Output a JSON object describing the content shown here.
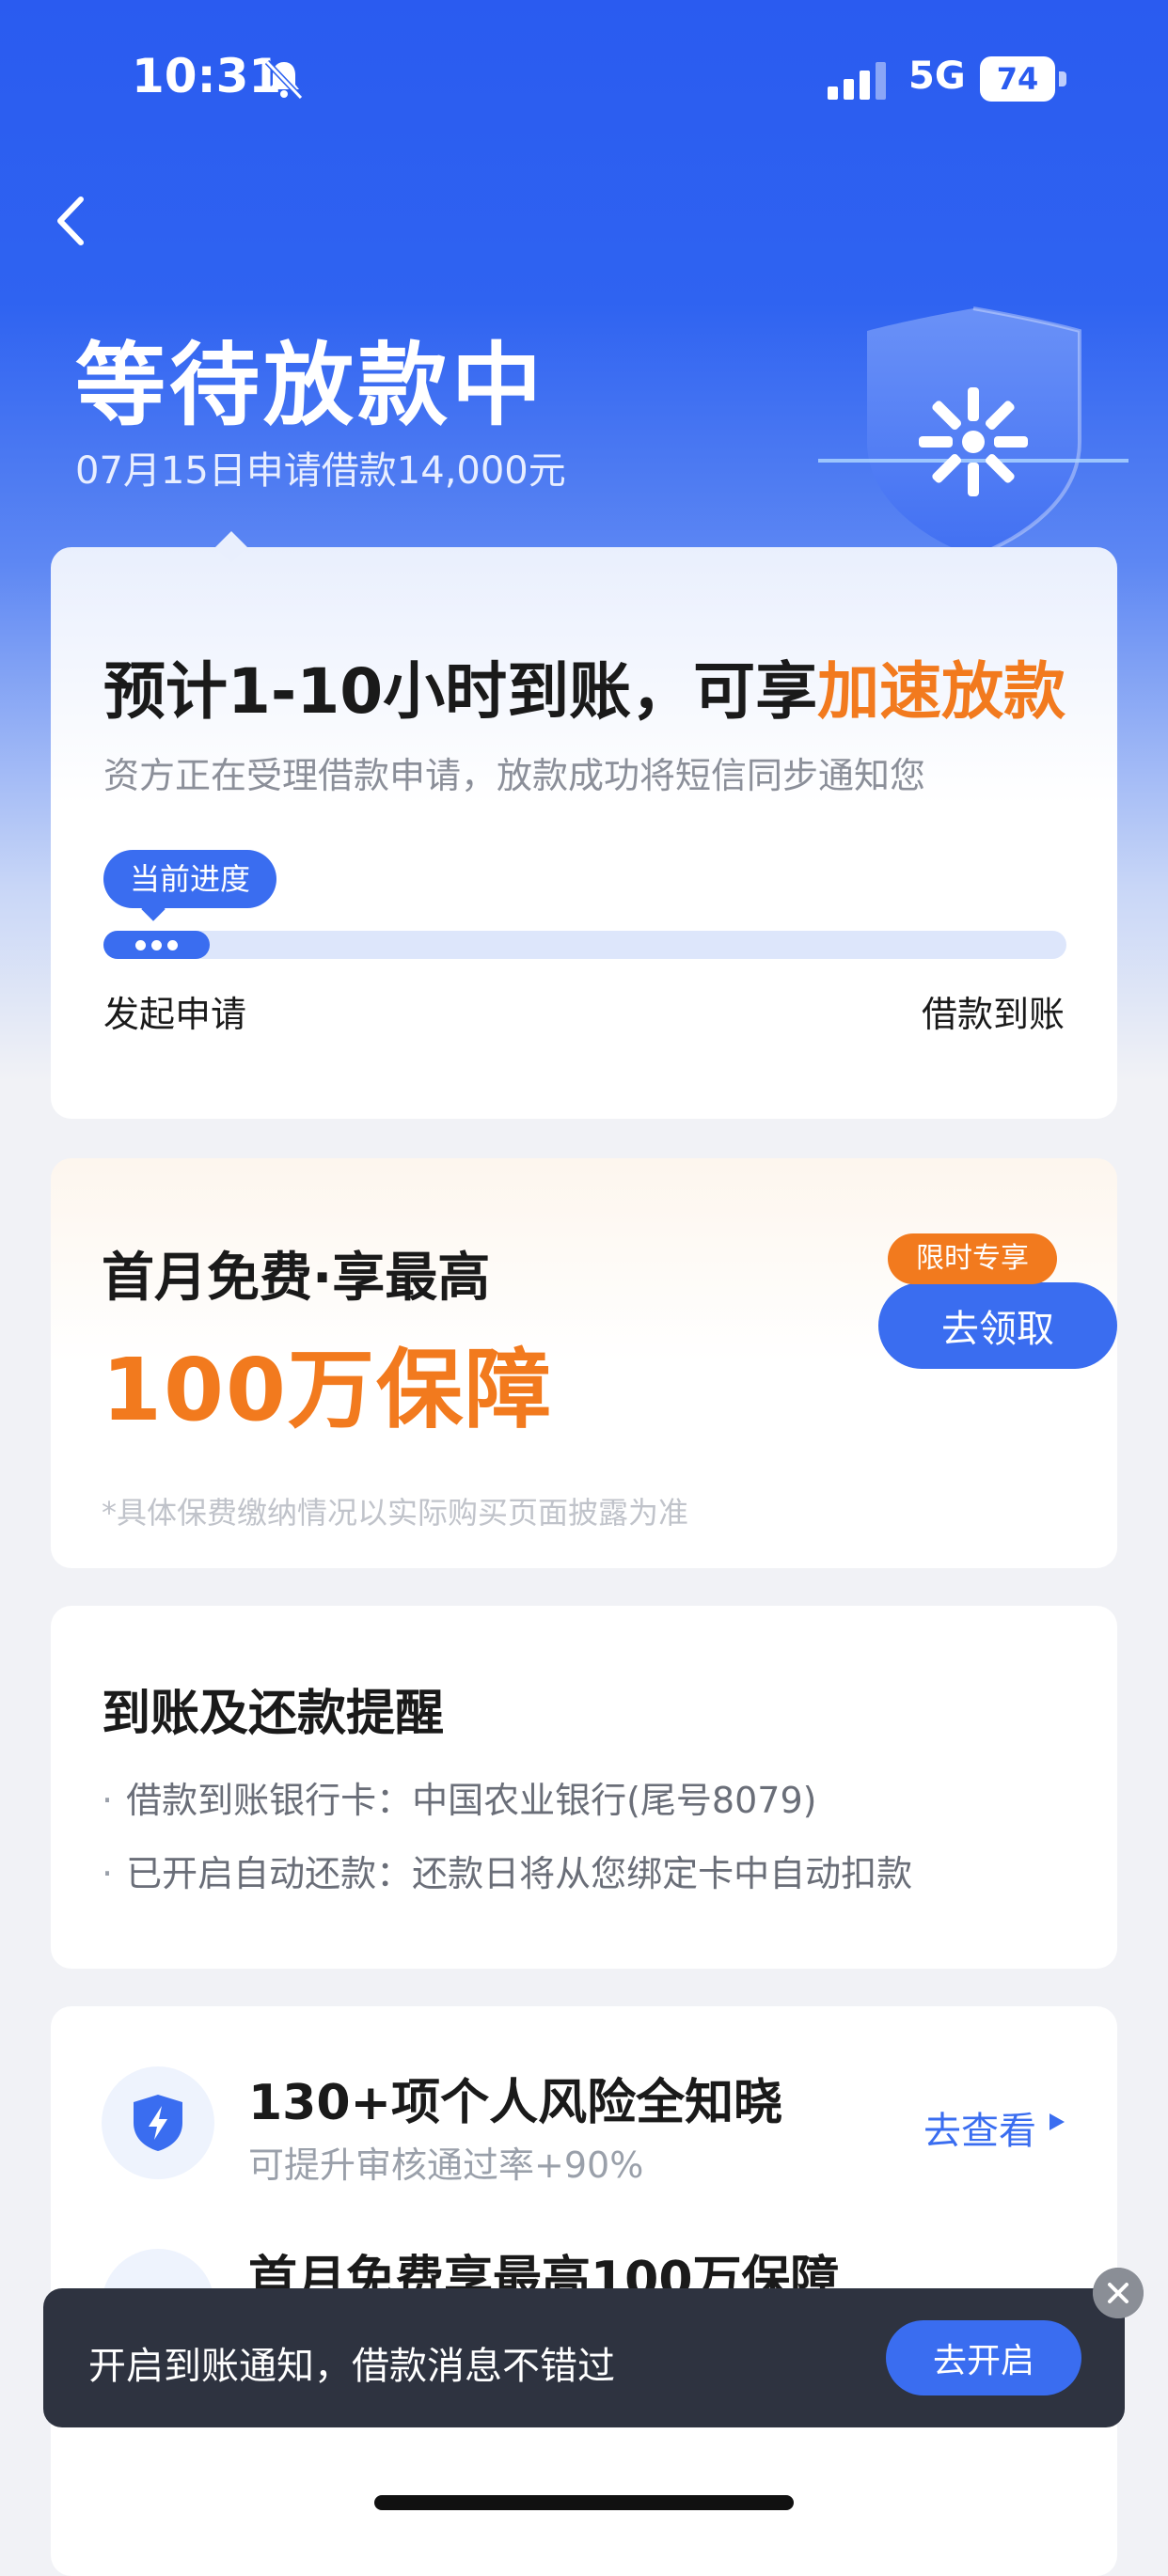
{
  "status_bar": {
    "time": "10:31",
    "network": "5G",
    "battery": "74"
  },
  "header": {
    "title": "等待放款中",
    "subtitle": "07月15日申请借款14,000元"
  },
  "progress_card": {
    "eta_prefix": "预计1-10小时到账，可享",
    "eta_accent": "加速放款",
    "description": "资方正在受理借款申请，放款成功将短信同步通知您",
    "badge": "当前进度",
    "progress_fraction": 0.11,
    "step_start": "发起申请",
    "step_end": "借款到账"
  },
  "insurance_card": {
    "line1": "首月免费·享最高",
    "line2": "100万保障",
    "tag": "限时专享",
    "button": "去领取",
    "note": "*具体保费缴纳情况以实际购买页面披露为准"
  },
  "reminder_card": {
    "title": "到账及还款提醒",
    "items": [
      "借款到账银行卡：中国农业银行(尾号8079)",
      "已开启自动还款：还款日将从您绑定卡中自动扣款"
    ]
  },
  "risk_card": {
    "title": "130+项个人风险全知晓",
    "subtitle": "可提升审核通过率+90%",
    "link": "去查看",
    "item2_title": "首月免费享最高100万保障"
  },
  "toast": {
    "text": "开启到账通知，借款消息不错过",
    "button": "去开启"
  },
  "colors": {
    "primary": "#3a6df0",
    "accent_orange": "#f27a1e",
    "hero_blue": "#2a5bf0",
    "toast_bg": "#2e3340"
  },
  "icons": [
    "bell-muted-icon",
    "signal-icon",
    "battery-icon",
    "back-icon",
    "shield-logo-icon",
    "lightning-shield-icon",
    "play-triangle-icon",
    "close-icon"
  ]
}
